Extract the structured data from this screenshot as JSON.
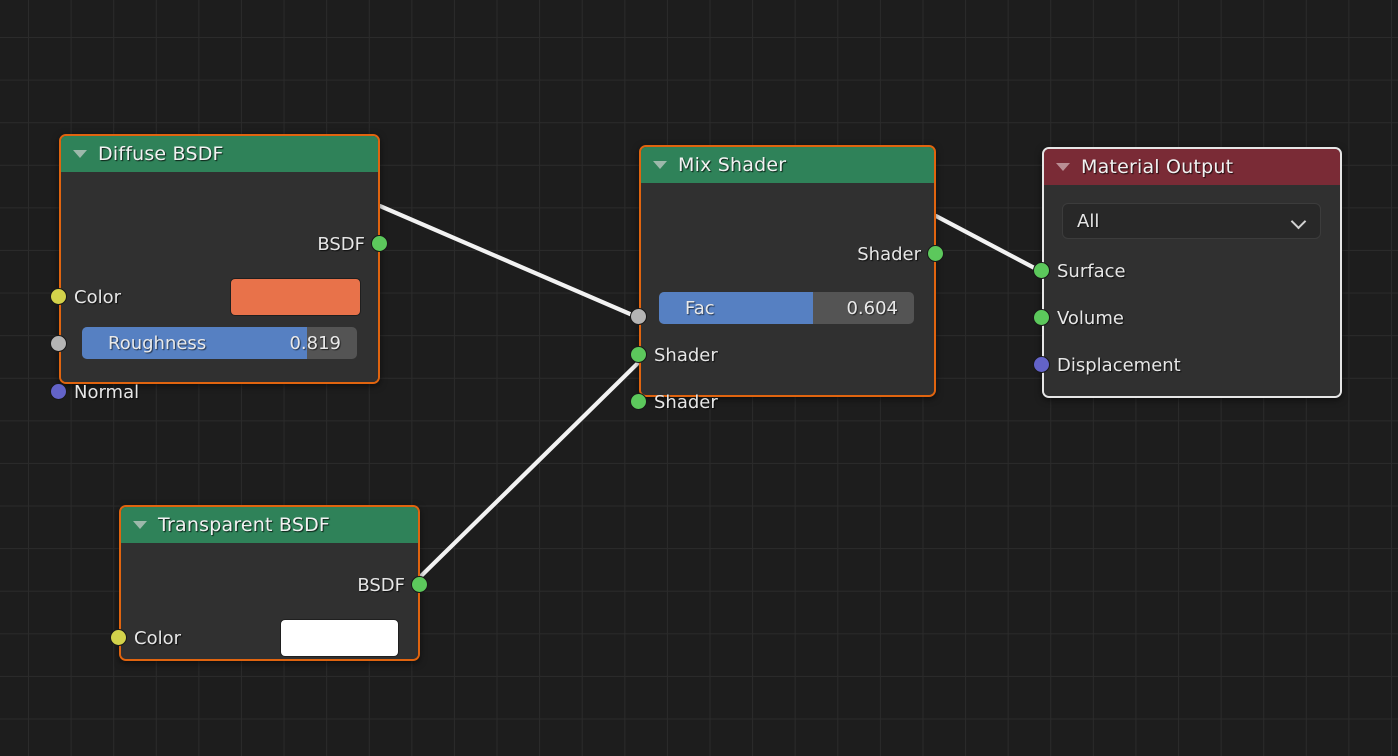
{
  "editor": {
    "name": "blender-shader-node-editor",
    "background_color": "#1d1d1d",
    "grid_color": "#2b2b2b"
  },
  "nodes": [
    {
      "id": "diffuse-bsdf",
      "title": "Diffuse BSDF",
      "header_color": "#2f8259",
      "border_color": "#e0640f",
      "collapse_icon": "collapse-triangle-icon",
      "outputs": [
        {
          "label": "BSDF",
          "socket_color": "#5cc85c",
          "socket_name": "green"
        }
      ],
      "inputs": [
        {
          "label": "Color",
          "socket_color": "#d2d24b",
          "socket_name": "yellow"
        },
        {
          "label": "Roughness",
          "socket_color": "#b4b4b4",
          "socket_name": "gray"
        },
        {
          "label": "Normal",
          "socket_color": "#6363c8",
          "socket_name": "purple"
        }
      ],
      "widgets": {
        "color_swatch": "#e8724a",
        "roughness_label": "Roughness",
        "roughness_value": "0.819",
        "roughness_fill_percent": 81.9
      }
    },
    {
      "id": "mix-shader",
      "title": "Mix Shader",
      "header_color": "#2f8259",
      "border_color": "#e0640f",
      "collapse_icon": "collapse-triangle-icon",
      "outputs": [
        {
          "label": "Shader",
          "socket_color": "#5cc85c",
          "socket_name": "green"
        }
      ],
      "inputs": [
        {
          "label": "Fac",
          "socket_color": "#b4b4b4",
          "socket_name": "gray"
        },
        {
          "label": "Shader",
          "socket_color": "#5cc85c",
          "socket_name": "green"
        },
        {
          "label": "Shader",
          "socket_color": "#5cc85c",
          "socket_name": "green"
        }
      ],
      "widgets": {
        "fac_label": "Fac",
        "fac_value": "0.604",
        "fac_fill_percent": 60.4
      }
    },
    {
      "id": "material-output",
      "title": "Material Output",
      "header_color": "#7a2b36",
      "border_color": "#e6e6e6",
      "collapse_icon": "collapse-triangle-icon",
      "inputs": [
        {
          "label": "Surface",
          "socket_color": "#5cc85c",
          "socket_name": "green"
        },
        {
          "label": "Volume",
          "socket_color": "#5cc85c",
          "socket_name": "green"
        },
        {
          "label": "Displacement",
          "socket_color": "#6363c8",
          "socket_name": "purple"
        }
      ],
      "widgets": {
        "target_dropdown_value": "All",
        "target_dropdown_icon": "chevron-down-icon"
      }
    },
    {
      "id": "transparent-bsdf",
      "title": "Transparent BSDF",
      "header_color": "#2f8259",
      "border_color": "#e0640f",
      "collapse_icon": "collapse-triangle-icon",
      "outputs": [
        {
          "label": "BSDF",
          "socket_color": "#5cc85c",
          "socket_name": "green"
        }
      ],
      "inputs": [
        {
          "label": "Color",
          "socket_color": "#d2d24b",
          "socket_name": "yellow"
        }
      ],
      "widgets": {
        "color_swatch": "#ffffff"
      }
    }
  ],
  "links": [
    {
      "from": "diffuse-bsdf.BSDF",
      "to": "mix-shader.Shader1",
      "color": "#ffffff"
    },
    {
      "from": "transparent-bsdf.BSDF",
      "to": "mix-shader.Shader2",
      "color": "#ffffff"
    },
    {
      "from": "mix-shader.Shader",
      "to": "material-output.Surface",
      "color": "#ffffff"
    }
  ]
}
